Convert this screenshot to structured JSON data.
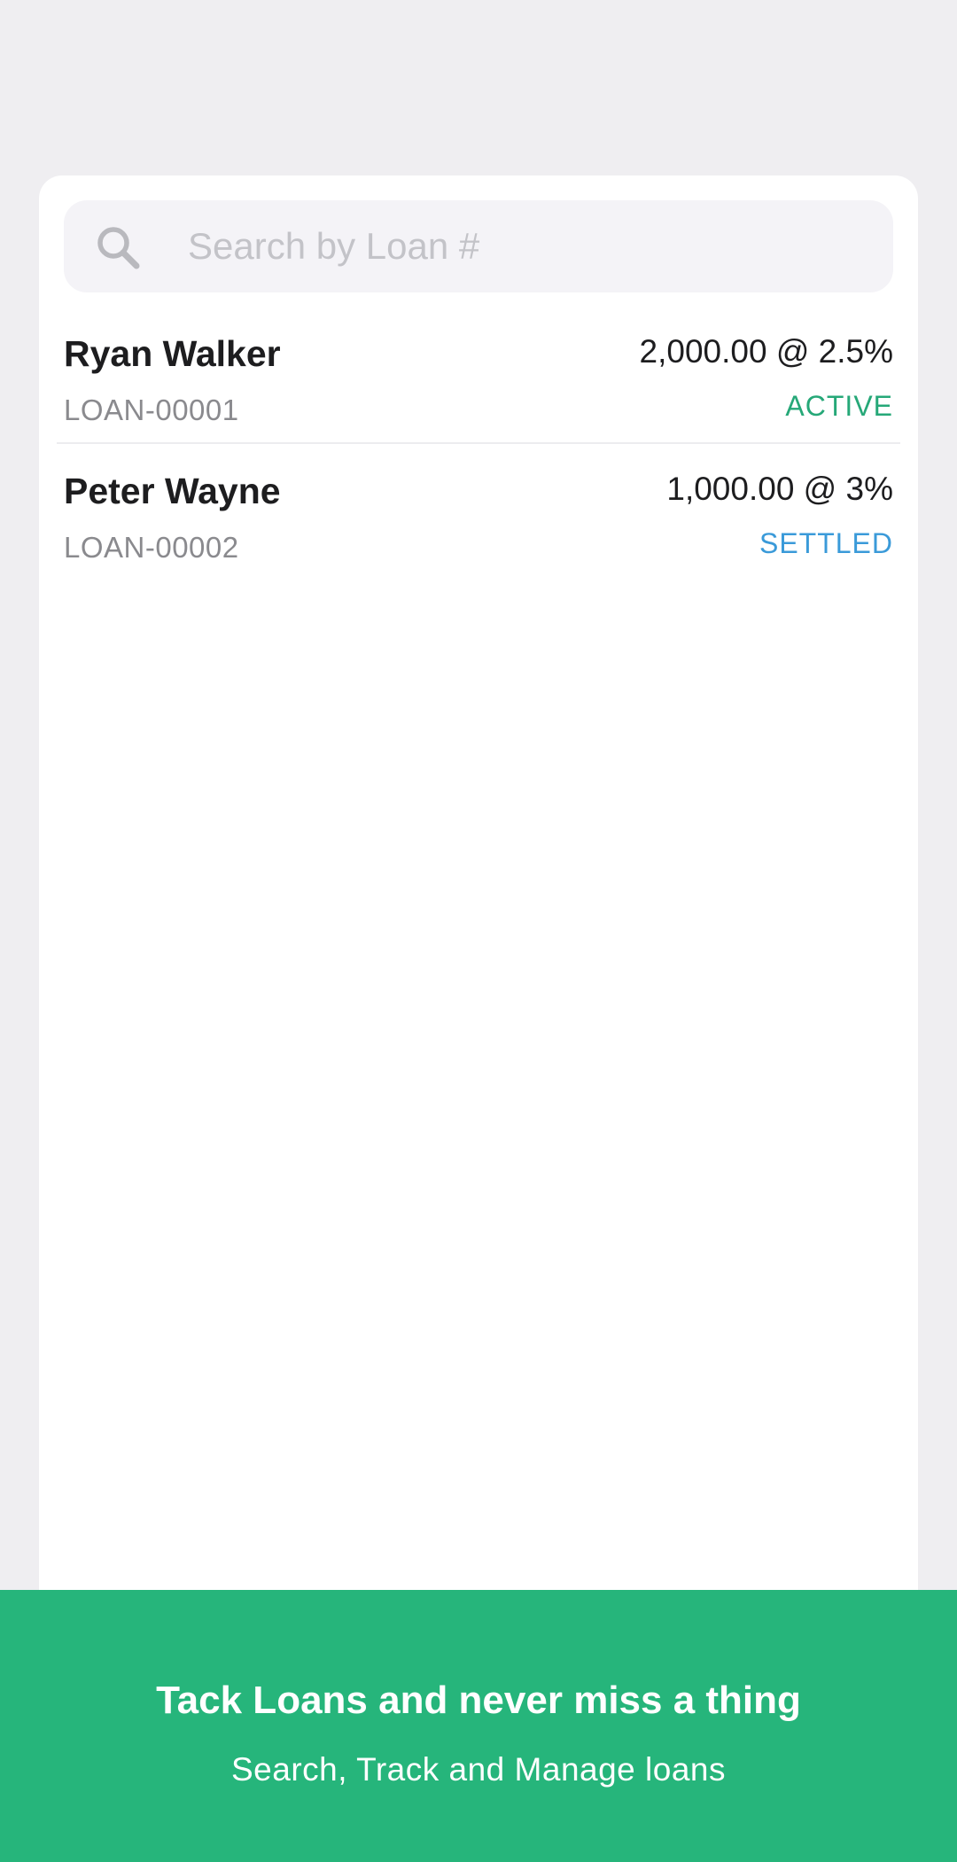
{
  "search": {
    "placeholder": "Search by Loan #",
    "value": ""
  },
  "loans": [
    {
      "borrower": "Ryan Walker",
      "loan_number": "LOAN-00001",
      "amount": "2,000.00 @ 2.5%",
      "status": "ACTIVE",
      "status_color": "#26a878"
    },
    {
      "borrower": "Peter Wayne",
      "loan_number": "LOAN-00002",
      "amount": "1,000.00 @ 3%",
      "status": "SETTLED",
      "status_color": "#3a9ad9"
    }
  ],
  "banner": {
    "title": "Tack Loans and never miss a thing",
    "subtitle": "Search, Track and Manage loans",
    "color": "#26b57b"
  },
  "icons": {
    "search": "search-icon"
  }
}
